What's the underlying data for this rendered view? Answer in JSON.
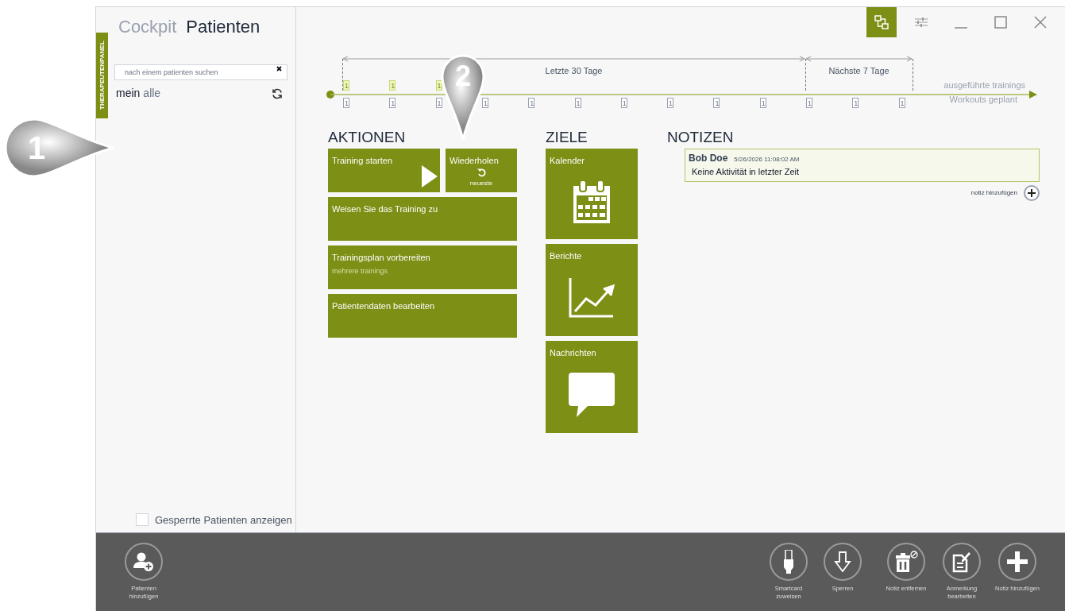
{
  "sidebar_tab": "THERAPEUTENPANEL",
  "header_tabs": [
    {
      "label": "Cockpit",
      "selected": false
    },
    {
      "label": "Patienten",
      "selected": true
    }
  ],
  "window_controls": [
    {
      "kind": "network",
      "selected": true
    },
    {
      "kind": "settings",
      "selected": false
    },
    {
      "kind": "minimize",
      "selected": false
    },
    {
      "kind": "maximize",
      "selected": false
    },
    {
      "kind": "close",
      "selected": false
    }
  ],
  "patient_panel": {
    "search": {
      "placeholder": "nach einem patienten suchen"
    },
    "filters": [
      {
        "label": "mein",
        "selected": true
      },
      {
        "label": "alle",
        "selected": false
      }
    ],
    "show_locked": {
      "label": "Gesperrte Patienten anzeigen",
      "checked": false
    }
  },
  "timeline": {
    "ranges": [
      "Letzte 30 Tage",
      "Nächste 7 Tage"
    ],
    "legend": [
      "ausgeführte trainings",
      "Workouts geplant"
    ],
    "ticks": [
      {
        "done": "1",
        "planned": "1"
      },
      {
        "done": "1",
        "planned": "1"
      },
      {
        "done": "1",
        "planned": "1"
      },
      {
        "planned": "1"
      },
      {
        "planned": "1"
      },
      {
        "planned": "1"
      },
      {
        "planned": "1"
      },
      {
        "planned": "1"
      },
      {
        "planned": "1"
      },
      {
        "planned": "1"
      },
      {
        "planned": "1"
      },
      {
        "planned": "1"
      },
      {
        "planned": "1"
      }
    ]
  },
  "callouts": [
    "1",
    "2"
  ],
  "aktionen": {
    "title": "AKTIONEN",
    "tiles": [
      {
        "kind": "play",
        "label": "Training starten"
      },
      {
        "kind": "repeat",
        "label": "Wiederholen",
        "sublabel": "neueste"
      },
      {
        "kind": "wide",
        "label": "Weisen Sie das Training zu"
      },
      {
        "kind": "wide",
        "label": "Trainingsplan vorbereiten",
        "sublabel": "mehrere trainings"
      },
      {
        "kind": "wide",
        "label": "Patientendaten bearbeiten"
      }
    ]
  },
  "ziele": {
    "title": "ZIELE",
    "tiles": [
      {
        "kind": "calendar",
        "label": "Kalender"
      },
      {
        "kind": "chart",
        "label": "Berichte"
      },
      {
        "kind": "message",
        "label": "Nachrichten"
      }
    ]
  },
  "notizen": {
    "title": "NOTIZEN",
    "notes": [
      {
        "author": "Bob Doe",
        "time": "5/26/2026 11:08:02 AM",
        "text": "Keine Aktivität in letzter Zeit"
      }
    ],
    "add_label": "notiz hinzufügen"
  },
  "bottom_bar": {
    "left": [
      {
        "kind": "add-patient",
        "label": "Patienten hinzufügen"
      }
    ],
    "right": [
      {
        "kind": "smartcard",
        "label": "Smartcard zuweisen"
      },
      {
        "kind": "lock",
        "label": "Sperren"
      },
      {
        "kind": "delete-note",
        "label": "Notiz entfernen"
      },
      {
        "kind": "edit-note",
        "label": "Anmerkung bearbeiten"
      },
      {
        "kind": "add",
        "label": "Notiz hinzufügen"
      }
    ]
  }
}
